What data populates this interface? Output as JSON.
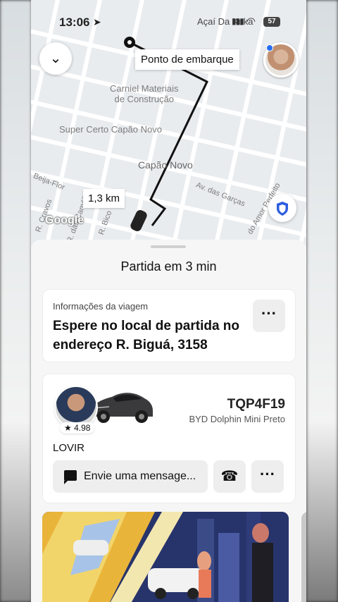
{
  "status_bar": {
    "time": "13:06",
    "carrier": "Açaí Da Keka",
    "battery": "57"
  },
  "map": {
    "pickup_label": "Ponto de embarque",
    "distance_label": "1,3 km",
    "places": [
      {
        "line1": "Carniel Materiais",
        "line2": "de Construção"
      },
      {
        "line1": "Super Certo Capão Novo",
        "line2": ""
      }
    ],
    "neighborhood": "Capão Novo",
    "streets": [
      "Av. das Garças",
      "Beija-Flor",
      "R. das Camélias",
      "R. Bico",
      "do Amor Perfeito",
      "R. Cravos"
    ],
    "google": "Google"
  },
  "sheet": {
    "title": "Partida em 3 min",
    "trip_info": {
      "subtitle": "Informações da viagem",
      "text": "Espere no local de partida no endereço R. Biguá, 3158",
      "more_label": "···"
    },
    "driver": {
      "rating": "★ 4.98",
      "name": "LOVIR",
      "plate": "TQP4F19",
      "car_model": "BYD Dolphin Mini Preto",
      "message_placeholder": "Envie uma mensage...",
      "phone_icon": "☎",
      "more_label": "···"
    }
  },
  "icons": {
    "collapse": "chevron-down-icon",
    "location": "location-arrow-icon",
    "shield": "shield-icon",
    "message": "message-icon",
    "phone": "phone-icon"
  },
  "colors": {
    "route": "#111111",
    "accent": "#276ef1",
    "shield": "#2d5ee0"
  }
}
